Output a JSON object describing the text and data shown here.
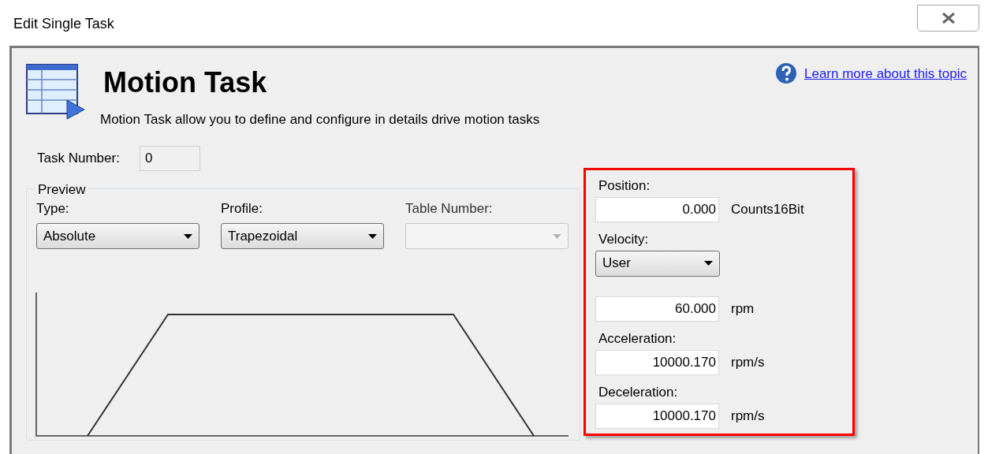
{
  "window": {
    "title": "Edit Single Task"
  },
  "header": {
    "title": "Motion Task",
    "description": "Motion Task allow you to define and configure in details drive motion tasks",
    "help_link": "Learn more about this topic"
  },
  "task_number": {
    "label": "Task Number:",
    "value": "0"
  },
  "preview": {
    "title": "Preview",
    "selectors": [
      {
        "label": "Type:",
        "value": "Absolute",
        "disabled": false
      },
      {
        "label": "Profile:",
        "value": "Trapezoidal",
        "disabled": false
      },
      {
        "label": "Table Number:",
        "disabled": true
      }
    ]
  },
  "parameters": [
    {
      "kind": "field",
      "label": "Position:",
      "value": "0.000",
      "unit": "Counts16Bit"
    },
    {
      "kind": "dropdown",
      "label": "Velocity:",
      "value": "User"
    },
    {
      "kind": "field",
      "value": "60.000",
      "unit": "rpm"
    },
    {
      "kind": "field",
      "label": "Acceleration:",
      "value": "10000.170",
      "unit": "rpm/s"
    },
    {
      "kind": "field",
      "label": "Deceleration:",
      "value": "10000.170",
      "unit": "rpm/s"
    }
  ]
}
